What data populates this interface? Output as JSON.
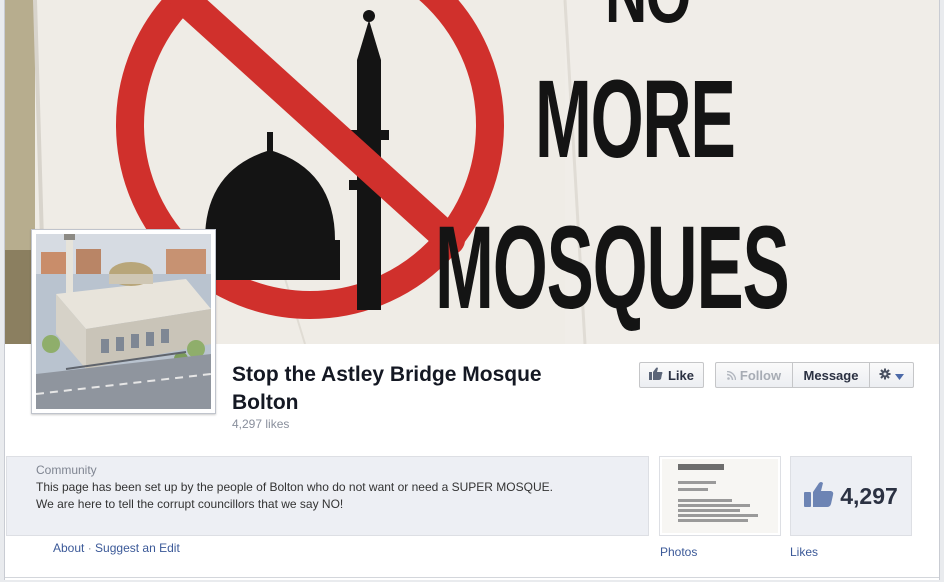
{
  "cover": {
    "banner_line1": "NO",
    "banner_line2": "MORE",
    "banner_line3": "MOSQUES",
    "colors": {
      "prohibition_red": "#d0302c",
      "banner_white": "#efece6",
      "ink_black": "#141414"
    }
  },
  "page": {
    "title": "Stop the Astley Bridge Mosque Bolton",
    "likes_line": "4,297 likes"
  },
  "actions": {
    "like_label": "Like",
    "follow_label": "Follow",
    "message_label": "Message"
  },
  "about": {
    "category": "Community",
    "description_line1": "This page has been set up by the people of Bolton who do not want or need a SUPER MOSQUE.",
    "description_line2": "We are here to tell the corrupt councillors that we say NO!",
    "about_link": "About",
    "separator": "·",
    "suggest_edit_link": "Suggest an Edit"
  },
  "tiles": {
    "photos_label": "Photos",
    "likes_label": "Likes",
    "likes_count": "4,297"
  },
  "icons": {
    "like": "thumbs-up-icon",
    "follow": "rss-icon",
    "settings": "gear-icon",
    "dropdown": "caret-down-icon"
  },
  "colors": {
    "link_blue": "#3b5998",
    "title_text": "#141823",
    "muted_text": "#898f9c",
    "panel_bg": "#edeff4"
  }
}
